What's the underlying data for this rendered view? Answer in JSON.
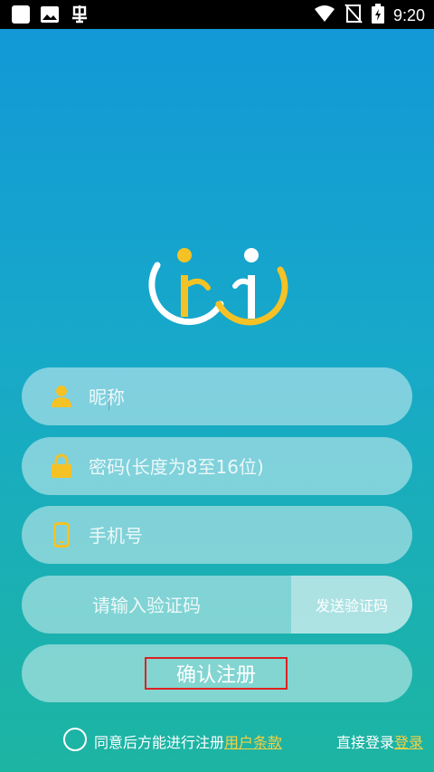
{
  "status_bar": {
    "time": "9:20",
    "left_icons": [
      "square-icon",
      "image-icon",
      "app-notification-icon"
    ],
    "right_icons": [
      "wifi-icon",
      "no-sim-icon",
      "battery-icon"
    ]
  },
  "logo": {
    "name": "app-logo",
    "colors": {
      "white": "#ffffff",
      "yellow": "#f5c225"
    }
  },
  "form": {
    "nickname": {
      "placeholder": "昵称",
      "icon": "user-icon"
    },
    "password": {
      "placeholder": "密码(长度为8至16位)",
      "icon": "lock-icon"
    },
    "phone": {
      "placeholder": "手机号",
      "icon": "phone-icon"
    },
    "code": {
      "placeholder": "请输入验证码",
      "send_label": "发送验证码"
    },
    "confirm_label": "确认注册"
  },
  "footer": {
    "agree_text": "同意后方能进行注册",
    "terms_link": "用户条款",
    "login_text": "直接登录",
    "login_link": "登录"
  },
  "colors": {
    "accent_yellow": "#f5c225",
    "link_yellow": "#f6d043",
    "gradient_top": "#1197d8",
    "gradient_bottom": "#1db5a2",
    "highlight_red": "#e02020"
  }
}
